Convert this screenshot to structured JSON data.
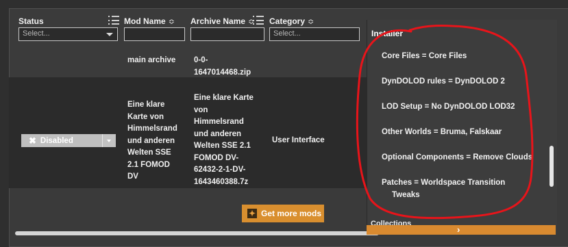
{
  "columns": {
    "status": "Status",
    "mod_name": "Mod Name",
    "archive_name": "Archive Name",
    "category": "Category"
  },
  "filters": {
    "status_placeholder": "Select...",
    "mod_name_value": "",
    "archive_name_value": "",
    "category_placeholder": "Select..."
  },
  "rows": [
    {
      "mod_name": "main archive",
      "archive_name_lines": [
        "0-0-",
        "1647014468.zip"
      ]
    },
    {
      "status": "Disabled",
      "mod_name_lines": [
        "Eine klare",
        "Karte von",
        "Himmelsrand",
        "und anderen",
        "Welten SSE",
        "2.1 FOMOD",
        "DV"
      ],
      "archive_name_lines": [
        "Eine klare Karte",
        "von",
        "Himmelsrand",
        "und anderen",
        "Welten SSE 2.1",
        "FOMOD DV-",
        "62432-2-1-DV-",
        "1643460388.7z"
      ],
      "category": "User Interface"
    }
  ],
  "get_more_mods": "Get more mods",
  "installer": {
    "title": "Installer",
    "items": [
      "Core Files = Core Files",
      "DynDOLOD rules = DynDOLOD 2",
      "LOD Setup = No DynDOLOD LOD32",
      "Other Worlds = Bruma, Falskaar",
      "Optional Components = Remove Clouds",
      "Patches = Worldspace Transition",
      "Tweaks"
    ],
    "cut_off_label": "Collections"
  },
  "colors": {
    "accent": "#d98f2f",
    "annotation_circle": "#e8141a",
    "row_dark": "#2b2b2b",
    "panel_bg": "#3a3a3a"
  }
}
